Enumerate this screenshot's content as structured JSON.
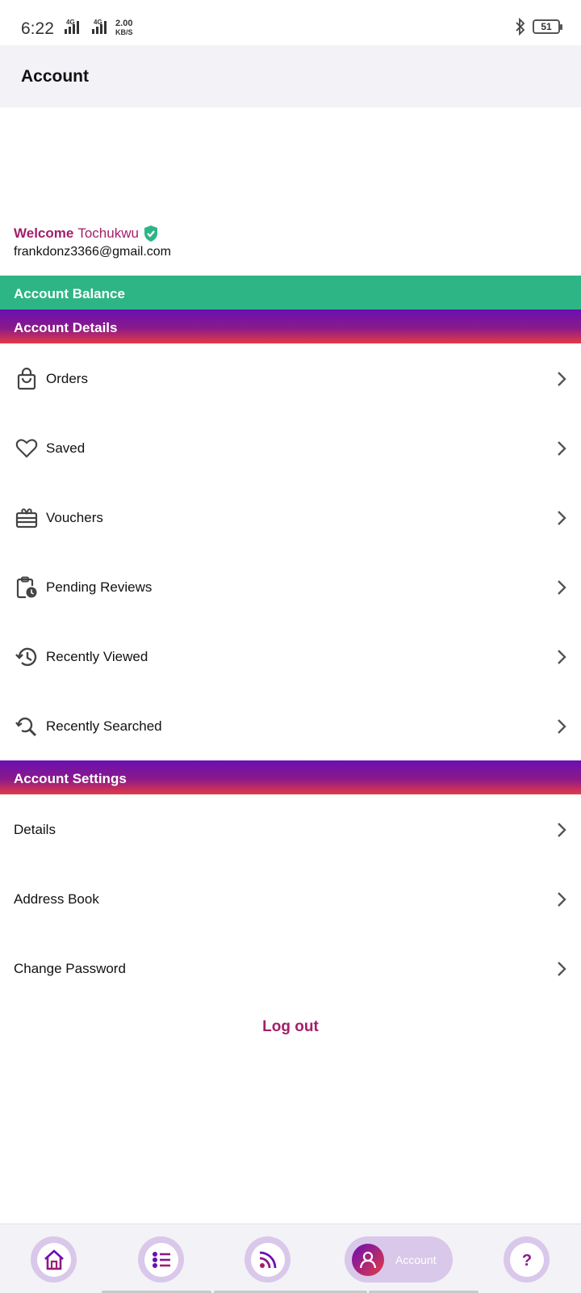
{
  "status_bar": {
    "time": "6:22",
    "net_1": "4G",
    "net_2": "4G",
    "speed_value": "2.00",
    "speed_unit": "KB/S",
    "battery": "51"
  },
  "app_bar": {
    "title": "Account"
  },
  "profile": {
    "welcome_word": "Welcome",
    "name": "Tochukwu",
    "email": "frankdonz3366@gmail.com"
  },
  "account_balance_label": "Account Balance",
  "account_details": {
    "title": "Account Details",
    "items": [
      {
        "label": "Orders",
        "icon": "shopping-bag-icon"
      },
      {
        "label": "Saved",
        "icon": "heart-icon"
      },
      {
        "label": "Vouchers",
        "icon": "gift-card-icon"
      },
      {
        "label": "Pending Reviews",
        "icon": "clipboard-clock-icon"
      },
      {
        "label": "Recently Viewed",
        "icon": "history-icon"
      },
      {
        "label": "Recently Searched",
        "icon": "search-history-icon"
      }
    ]
  },
  "account_settings": {
    "title": "Account Settings",
    "items": [
      {
        "label": "Details"
      },
      {
        "label": "Address Book"
      },
      {
        "label": "Change Password"
      }
    ]
  },
  "logout_label": "Log out",
  "bottom_nav": {
    "items": [
      {
        "icon": "home-icon"
      },
      {
        "icon": "categories-icon"
      },
      {
        "icon": "feed-icon"
      },
      {
        "icon": "account-icon",
        "label": "Account",
        "active": true
      },
      {
        "icon": "help-icon"
      }
    ]
  },
  "colors": {
    "brand": "#a31e6a",
    "balance_green": "#2db586",
    "gradient_top": "#6a0fb2",
    "gradient_bottom": "#e43a45",
    "nav_pill": "#d9c8ea"
  }
}
